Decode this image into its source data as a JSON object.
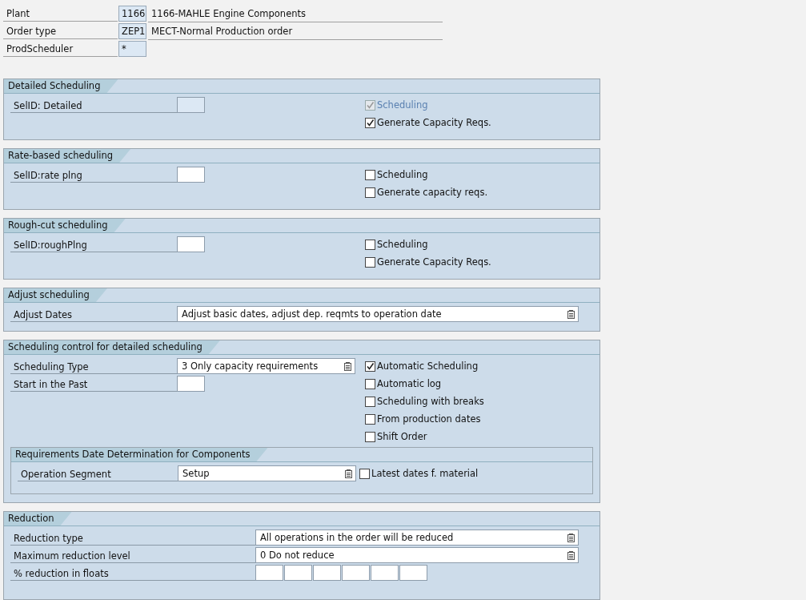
{
  "header": [
    {
      "label": "Plant",
      "value": "1166",
      "description": "1166-MAHLE Engine Components"
    },
    {
      "label": "Order type",
      "value": "ZEP1",
      "description": "MECT-Normal Production order"
    },
    {
      "label": "ProdScheduler",
      "value": "*"
    }
  ],
  "sections": [
    {
      "title": "Detailed Scheduling",
      "kind": "standard",
      "rows": [
        {
          "field": {
            "label": "SelID: Detailed",
            "control": {
              "kind": "input",
              "disabled": true
            }
          },
          "check": {
            "label": "Scheduling",
            "checked": true,
            "disabled": true
          }
        },
        {
          "check": {
            "label": "Generate Capacity Reqs.",
            "checked": true,
            "disabled": false
          }
        }
      ]
    },
    {
      "title": "Rate-based scheduling",
      "kind": "standard",
      "rows": [
        {
          "field": {
            "label": "SelID:rate plng",
            "control": {
              "kind": "input",
              "disabled": false
            }
          },
          "check": {
            "label": "Scheduling",
            "checked": false,
            "disabled": false
          }
        },
        {
          "check": {
            "label": "Generate capacity reqs.",
            "checked": false,
            "disabled": false
          }
        }
      ]
    },
    {
      "title": "Rough-cut scheduling",
      "kind": "standard",
      "rows": [
        {
          "field": {
            "label": "SelID:roughPlng",
            "control": {
              "kind": "input",
              "disabled": false
            }
          },
          "check": {
            "label": "Scheduling",
            "checked": false,
            "disabled": false
          }
        },
        {
          "check": {
            "label": "Generate Capacity Reqs.",
            "checked": false,
            "disabled": false
          }
        }
      ]
    },
    {
      "title": "Adjust scheduling",
      "kind": "standard",
      "rows": [
        {
          "kind": "wide",
          "field": {
            "label": "Adjust Dates",
            "control": {
              "kind": "dropdown",
              "value": "Adjust basic dates, adjust dep. reqmts to operation date"
            }
          }
        }
      ]
    },
    {
      "title": "Scheduling control for detailed scheduling",
      "kind": "standard",
      "rows": [
        {
          "field": {
            "label": "Scheduling Type",
            "control": {
              "kind": "dropdown",
              "value": "3 Only capacity requirements"
            }
          },
          "check": {
            "label": "Automatic Scheduling",
            "checked": true,
            "disabled": false
          }
        },
        {
          "field": {
            "label": "Start in the Past",
            "control": {
              "kind": "input",
              "disabled": false
            }
          },
          "check": {
            "label": "Automatic log",
            "checked": false,
            "disabled": false
          }
        },
        {
          "check": {
            "label": "Scheduling with breaks",
            "checked": false,
            "disabled": false
          }
        },
        {
          "check": {
            "label": "From production dates",
            "checked": false,
            "disabled": false
          }
        },
        {
          "check": {
            "label": "Shift Order",
            "checked": false,
            "disabled": false
          }
        }
      ],
      "subsection": {
        "title": "Requirements Date Determination for Components",
        "rows": [
          {
            "field": {
              "label": "Operation Segment",
              "control": {
                "kind": "dropdown",
                "value": "Setup"
              }
            },
            "check": {
              "label": "Latest dates f. material",
              "checked": false,
              "disabled": false
            }
          }
        ]
      }
    },
    {
      "title": "Reduction",
      "kind": "reduction",
      "rows": [
        {
          "kind": "wide",
          "field": {
            "label": "Reduction type",
            "control": {
              "kind": "dropdown",
              "value": "All operations in the order will be reduced"
            }
          }
        },
        {
          "kind": "wide",
          "field": {
            "label": "Maximum reduction level",
            "control": {
              "kind": "dropdown",
              "value": "0 Do not reduce"
            }
          }
        },
        {
          "kind": "wide",
          "field": {
            "label": "% reduction in floats",
            "control": {
              "kind": "multi",
              "inputs": [
                {
                  "kind": "input"
                },
                {
                  "kind": "input"
                },
                {
                  "kind": "input"
                },
                {
                  "kind": "input"
                },
                {
                  "kind": "input"
                },
                {
                  "kind": "input"
                }
              ]
            }
          }
        }
      ]
    }
  ]
}
